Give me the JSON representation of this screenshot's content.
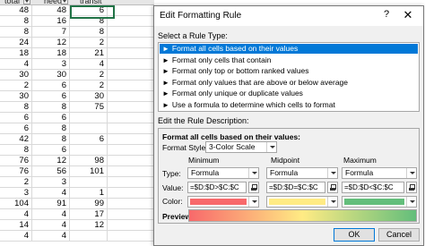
{
  "sheet": {
    "headers": [
      "total",
      "need",
      "transit"
    ],
    "rows": [
      [
        "48",
        "48",
        "6"
      ],
      [
        "8",
        "16",
        "8"
      ],
      [
        "8",
        "7",
        "8"
      ],
      [
        "24",
        "12",
        "2"
      ],
      [
        "18",
        "18",
        "21"
      ],
      [
        "4",
        "3",
        "4"
      ],
      [
        "30",
        "30",
        "2"
      ],
      [
        "2",
        "6",
        "2"
      ],
      [
        "30",
        "6",
        "30"
      ],
      [
        "8",
        "8",
        "75"
      ],
      [
        "6",
        "6",
        ""
      ],
      [
        "6",
        "8",
        ""
      ],
      [
        "42",
        "8",
        "6"
      ],
      [
        "8",
        "6",
        ""
      ],
      [
        "76",
        "12",
        "98"
      ],
      [
        "76",
        "56",
        "101"
      ],
      [
        "2",
        "3",
        ""
      ],
      [
        "3",
        "4",
        "1"
      ],
      [
        "104",
        "91",
        "99"
      ],
      [
        "4",
        "4",
        "17"
      ],
      [
        "14",
        "4",
        "12"
      ],
      [
        "4",
        "4",
        ""
      ]
    ]
  },
  "dialog": {
    "title": "Edit Formatting Rule",
    "help_glyph": "?",
    "close_glyph": "✕",
    "select_rule_type_label": "Select a Rule Type:",
    "rule_types": [
      "Format all cells based on their values",
      "Format only cells that contain",
      "Format only top or bottom ranked values",
      "Format only values that are above or below average",
      "Format only unique or duplicate values",
      "Use a formula to determine which cells to format"
    ],
    "selected_rule_index": 0,
    "edit_description_label": "Edit the Rule Description:",
    "description_heading": "Format all cells based on their values:",
    "format_style_label": "Format Style:",
    "format_style_value": "3-Color Scale",
    "columns": {
      "minimum": "Minimum",
      "midpoint": "Midpoint",
      "maximum": "Maximum"
    },
    "type_label": "Type:",
    "value_label": "Value:",
    "color_label": "Color:",
    "types": {
      "minimum": "Formula",
      "midpoint": "Formula",
      "maximum": "Formula"
    },
    "values": {
      "minimum": "=$D:$D>$C:$C",
      "midpoint": "=$D:$D=$C:$C",
      "maximum": "=$D:$D<$C:$C"
    },
    "colors": {
      "minimum": "#f8696b",
      "midpoint": "#ffeb84",
      "maximum": "#63be7b"
    },
    "preview_label": "Preview:",
    "ok_label": "OK",
    "cancel_label": "Cancel"
  }
}
